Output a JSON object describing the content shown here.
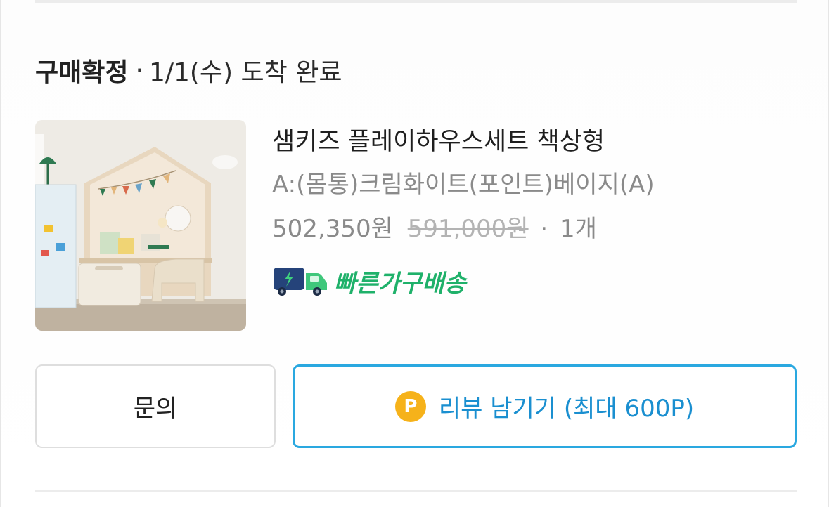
{
  "order": {
    "status": "구매확정",
    "separator": "·",
    "delivery_info": "1/1(수) 도착 완료"
  },
  "product": {
    "image_alt": "플레이하우스 책상 제품 이미지",
    "name": "샘키즈 플레이하우스세트 책상형",
    "option": "A:(몸통)크림화이트(포인트)베이지(A)",
    "price": "502,350원",
    "original_price": "591,000원",
    "quantity": "1개",
    "delivery_badge": {
      "icon": "truck-icon",
      "label": "빠른가구배송",
      "color": "#1fb16a"
    }
  },
  "actions": {
    "inquiry_label": "문의",
    "review_icon": "P",
    "review_label": "리뷰 남기기 (최대 600P)"
  },
  "colors": {
    "accent_blue": "#2aa8e0",
    "point_yellow": "#f6b21a"
  }
}
